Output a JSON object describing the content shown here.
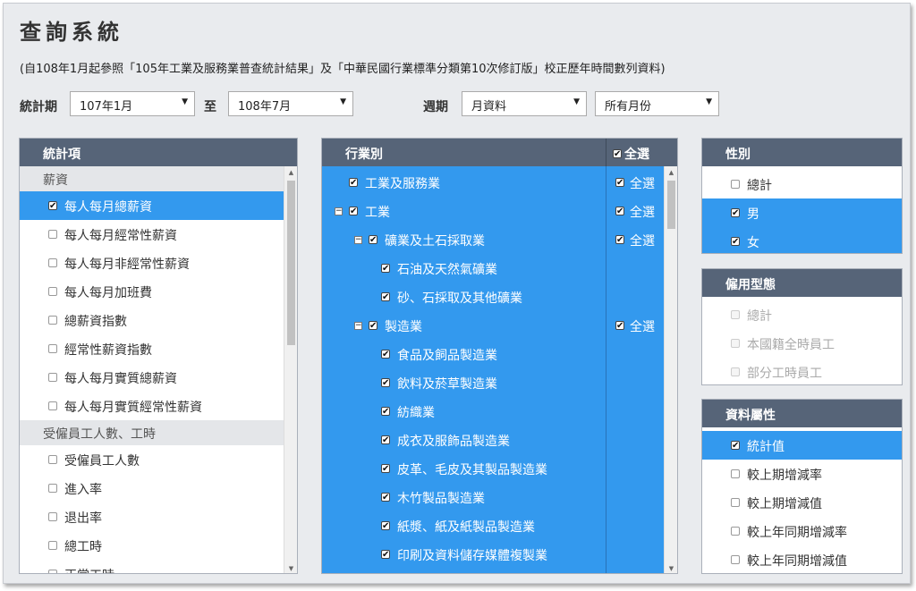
{
  "header": {
    "title": "查詢系統",
    "subtitle": "(自108年1月起參照「105年工業及服務業普查統計結果」及「中華民國行業標準分類第10次修訂版」校正歷年時間數列資料)"
  },
  "filters": {
    "period_label": "統計期",
    "start": "107年1月",
    "to_label": "至",
    "end": "108年7月",
    "cycle_label": "週期",
    "cycle": "月資料",
    "months": "所有月份"
  },
  "stats_panel": {
    "title": "統計項",
    "groups": [
      {
        "label": "薪資",
        "items": [
          {
            "label": "每人每月總薪資",
            "checked": true
          },
          {
            "label": "每人每月經常性薪資",
            "checked": false
          },
          {
            "label": "每人每月非經常性薪資",
            "checked": false
          },
          {
            "label": "每人每月加班費",
            "checked": false
          },
          {
            "label": "總薪資指數",
            "checked": false
          },
          {
            "label": "經常性薪資指數",
            "checked": false
          },
          {
            "label": "每人每月實質總薪資",
            "checked": false
          },
          {
            "label": "每人每月實質經常性薪資",
            "checked": false
          }
        ]
      },
      {
        "label": "受僱員工人數、工時",
        "items": [
          {
            "label": "受僱員工人數",
            "checked": false
          },
          {
            "label": "進入率",
            "checked": false
          },
          {
            "label": "退出率",
            "checked": false
          },
          {
            "label": "總工時",
            "checked": false
          },
          {
            "label": "正常工時",
            "checked": false
          }
        ]
      }
    ]
  },
  "industry_panel": {
    "title": "行業別",
    "select_all": "全選",
    "items": [
      {
        "label": "工業及服務業",
        "level": 0,
        "expandable": false,
        "all": true
      },
      {
        "label": "工業",
        "level": 0,
        "expandable": true,
        "all": true
      },
      {
        "label": "礦業及土石採取業",
        "level": 1,
        "expandable": true,
        "all": true
      },
      {
        "label": "石油及天然氣礦業",
        "level": 2,
        "expandable": false,
        "all": false
      },
      {
        "label": "砂、石採取及其他礦業",
        "level": 2,
        "expandable": false,
        "all": false
      },
      {
        "label": "製造業",
        "level": 1,
        "expandable": true,
        "all": true
      },
      {
        "label": "食品及飼品製造業",
        "level": 2,
        "expandable": false,
        "all": false
      },
      {
        "label": "飲料及菸草製造業",
        "level": 2,
        "expandable": false,
        "all": false
      },
      {
        "label": "紡織業",
        "level": 2,
        "expandable": false,
        "all": false
      },
      {
        "label": "成衣及服飾品製造業",
        "level": 2,
        "expandable": false,
        "all": false
      },
      {
        "label": "皮革、毛皮及其製品製造業",
        "level": 2,
        "expandable": false,
        "all": false
      },
      {
        "label": "木竹製品製造業",
        "level": 2,
        "expandable": false,
        "all": false
      },
      {
        "label": "紙漿、紙及紙製品製造業",
        "level": 2,
        "expandable": false,
        "all": false
      },
      {
        "label": "印刷及資料儲存媒體複製業",
        "level": 2,
        "expandable": false,
        "all": false
      }
    ]
  },
  "gender_panel": {
    "title": "性別",
    "items": [
      {
        "label": "總計",
        "checked": false
      },
      {
        "label": "男",
        "checked": true
      },
      {
        "label": "女",
        "checked": true
      }
    ]
  },
  "employment_panel": {
    "title": "僱用型態",
    "items": [
      {
        "label": "總計",
        "checked": false
      },
      {
        "label": "本國籍全時員工",
        "checked": false
      },
      {
        "label": "部分工時員工",
        "checked": false
      }
    ]
  },
  "attribute_panel": {
    "title": "資料屬性",
    "items": [
      {
        "label": "統計值",
        "checked": true
      },
      {
        "label": "較上期增減率",
        "checked": false
      },
      {
        "label": "較上期增減值",
        "checked": false
      },
      {
        "label": "較上年同期增減率",
        "checked": false
      },
      {
        "label": "較上年同期增減值",
        "checked": false
      }
    ]
  },
  "colors": {
    "header_bar": "#566478",
    "selected": "#3399ee",
    "background": "#e9ebee"
  }
}
